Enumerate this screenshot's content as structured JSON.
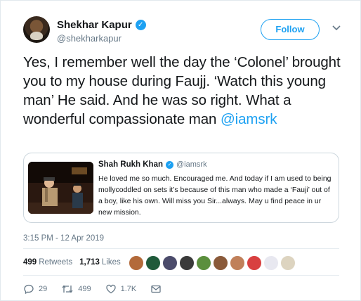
{
  "author": {
    "display_name": "Shekhar Kapur",
    "handle": "@shekharkapur",
    "verified_icon": "verified-badge-icon"
  },
  "header": {
    "follow_label": "Follow"
  },
  "tweet": {
    "text": "Yes, I remember well the day the ‘Colonel’ brought you to my house during Faujj. ‘Watch this young man’ He said. And he was so right. What a wonderful compassionate man ",
    "mention": "@iamsrk"
  },
  "quoted_tweet": {
    "display_name": "Shah Rukh Khan",
    "handle": "@iamsrk",
    "text": "He loved me so much. Encouraged me. And today if I am used to being mollycoddled on sets it’s because of this man who made a ‘Fauji’ out of a boy, like his own. Will miss you Sir...always. May u find peace in ur new mission."
  },
  "timestamp": "3:15 PM - 12 Apr 2019",
  "stats": {
    "retweets_count": "499",
    "retweets_label": "Retweets",
    "likes_count": "1,713",
    "likes_label": "Likes"
  },
  "liker_avatar_colors": [
    "#b36a3a",
    "#1f5a3a",
    "#4b4b6b",
    "#3a3a3a",
    "#5b8f3d",
    "#8a5a3a",
    "#c0805a",
    "#d84040",
    "#e8e8f0",
    "#ddd4c0"
  ],
  "actions": {
    "replies": "29",
    "retweets": "499",
    "likes": "1.7K"
  },
  "colors": {
    "accent": "#1da1f2",
    "muted": "#657786",
    "text": "#14171a"
  }
}
